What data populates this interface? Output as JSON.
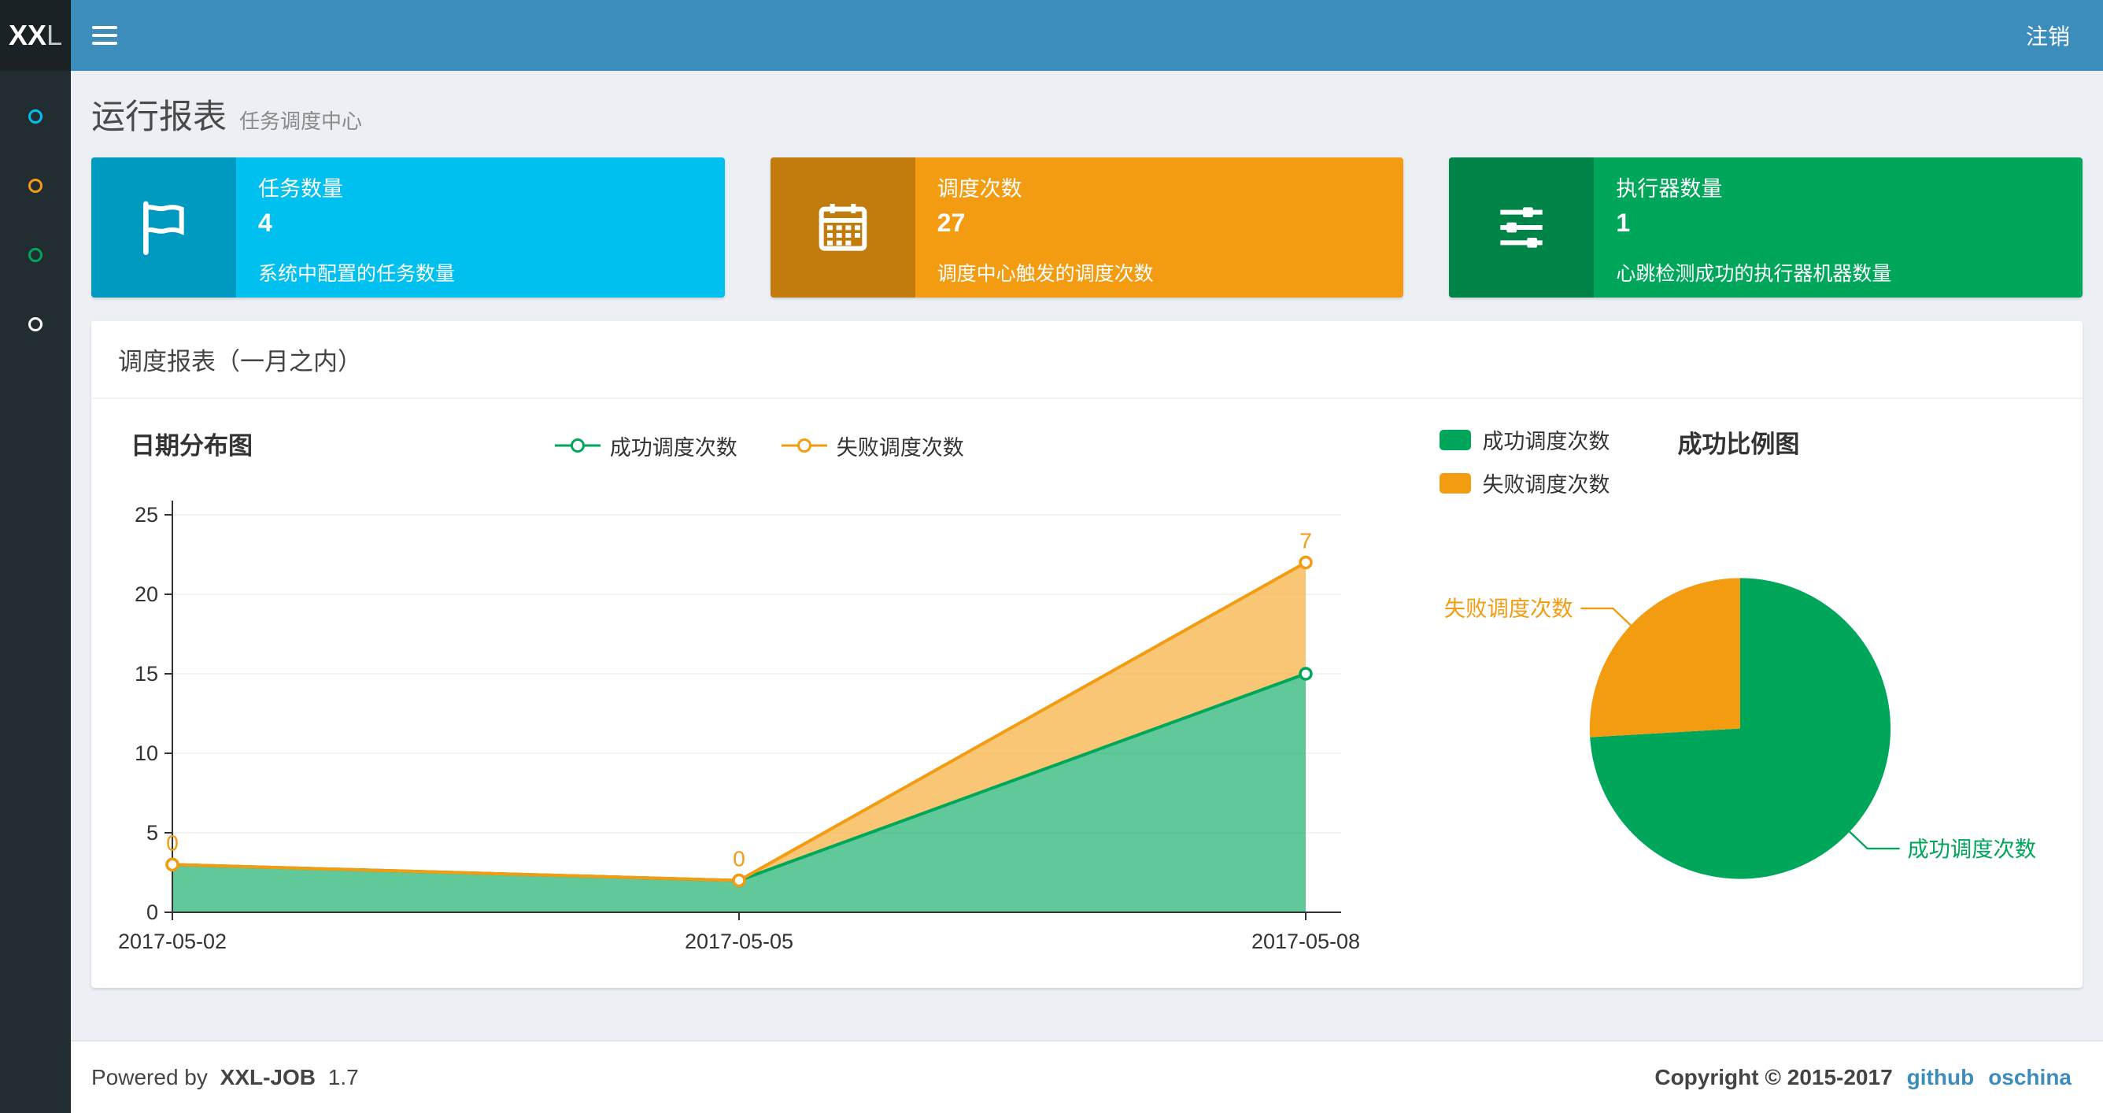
{
  "navbar": {
    "logo_bold": "XX",
    "logo_light": "L",
    "logout": "注销"
  },
  "sidebar": {
    "items": [
      {
        "color": "#00c0ef"
      },
      {
        "color": "#f39c12"
      },
      {
        "color": "#00a65a"
      },
      {
        "color": "#ffffff"
      }
    ]
  },
  "page_header": {
    "title": "运行报表",
    "subtitle": "任务调度中心"
  },
  "info_boxes": [
    {
      "icon": "flag-icon",
      "color": "#00c0ef",
      "title": "任务数量",
      "value": "4",
      "desc": "系统中配置的任务数量"
    },
    {
      "icon": "calendar-icon",
      "color": "#f39c12",
      "title": "调度次数",
      "value": "27",
      "desc": "调度中心触发的调度次数"
    },
    {
      "icon": "sliders-icon",
      "color": "#00a65a",
      "title": "执行器数量",
      "value": "1",
      "desc": "心跳检测成功的执行器机器数量"
    }
  ],
  "panel": {
    "title": "调度报表（一月之内）"
  },
  "chart_data": [
    {
      "type": "area",
      "title": "日期分布图",
      "stacked": true,
      "x": [
        "2017-05-02",
        "2017-05-05",
        "2017-05-08"
      ],
      "series": [
        {
          "name": "成功调度次数",
          "color": "#00a65a",
          "values": [
            3,
            2,
            15
          ]
        },
        {
          "name": "失败调度次数",
          "color": "#f39c12",
          "values": [
            0,
            0,
            7
          ],
          "show_point_labels": true
        }
      ],
      "ylim": [
        0,
        25
      ],
      "yticks": [
        0,
        5,
        10,
        15,
        20,
        25
      ],
      "legend_position": "top-center",
      "grid": true
    },
    {
      "type": "pie",
      "title": "成功比例图",
      "slices": [
        {
          "name": "成功调度次数",
          "value": 20,
          "color": "#00a65a"
        },
        {
          "name": "失败调度次数",
          "value": 7,
          "color": "#f39c12"
        }
      ],
      "legend_position": "top-left"
    }
  ],
  "footer": {
    "powered_prefix": "Powered by",
    "brand": "XXL-JOB",
    "version": "1.7",
    "copyright": "Copyright © 2015-2017",
    "links": [
      {
        "label": "github"
      },
      {
        "label": "oschina"
      }
    ]
  }
}
